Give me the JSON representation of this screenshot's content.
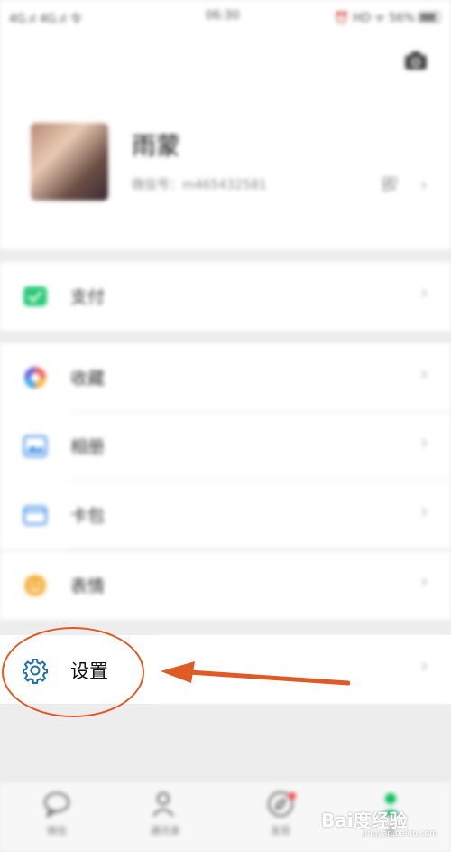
{
  "status_bar": {
    "carrier": "4G.ıl 4G.ıl 令",
    "time": "06:30",
    "indicators": "⏰ HD ᯤ 56%"
  },
  "profile": {
    "nickname": "雨蒙",
    "wechat_id": "微信号：m465432581"
  },
  "menu": {
    "pay": "支付",
    "favorites": "收藏",
    "album": "相册",
    "wallet": "卡包",
    "stickers": "表情",
    "settings": "设置"
  },
  "tabbar": {
    "chats": "微信",
    "contacts": "通讯录",
    "discover": "发现",
    "me": "我"
  },
  "watermark": {
    "brand": "Bai度经验",
    "url": "jingyan.baidu.com"
  },
  "colors": {
    "annotation": "#e05a25",
    "settings_icon": "#1f6fa8",
    "pay_icon": "#07c160"
  }
}
